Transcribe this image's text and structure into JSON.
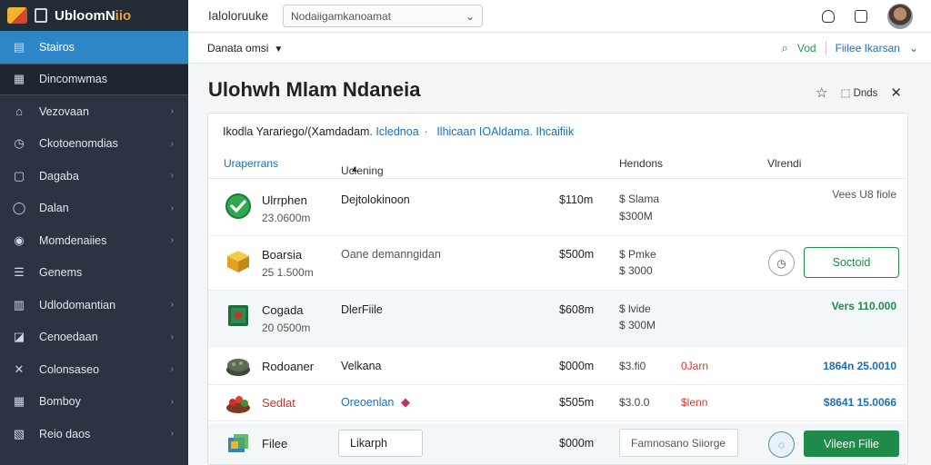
{
  "app": {
    "name_main": "UbloomN",
    "name_accent": "iio",
    "title": "Ialoloruuke"
  },
  "search": {
    "value": "Nodaiigamkanoamat"
  },
  "sidebar": {
    "items": [
      {
        "label": "Stairos",
        "icon": "dashboard-icon",
        "chevron": ""
      },
      {
        "label": "Dincomwmas",
        "icon": "pages-icon",
        "chevron": ""
      },
      {
        "label": "Vezovaan",
        "icon": "home-icon",
        "chevron": "›"
      },
      {
        "label": "Ckotoenomdias",
        "icon": "clock-icon",
        "chevron": "›"
      },
      {
        "label": "Dagaba",
        "icon": "box-icon",
        "chevron": "›"
      },
      {
        "label": "Dalan",
        "icon": "circle-icon",
        "chevron": "›"
      },
      {
        "label": "Momdenaiies",
        "icon": "target-icon",
        "chevron": "›"
      },
      {
        "label": "Genems",
        "icon": "list-icon",
        "chevron": ""
      },
      {
        "label": "Udlodomantian",
        "icon": "book-icon",
        "chevron": "›"
      },
      {
        "label": "Cenoedaan",
        "icon": "tag-icon",
        "chevron": "›"
      },
      {
        "label": "Colonsaseo",
        "icon": "tools-icon",
        "chevron": "›"
      },
      {
        "label": "Bomboy",
        "icon": "calendar-icon",
        "chevron": "›"
      },
      {
        "label": "Reio daos",
        "icon": "files-icon",
        "chevron": "›"
      }
    ]
  },
  "subbar": {
    "dataset": "Danata omsi",
    "vod": "Vod",
    "filter": "Fiilee Ikarsan"
  },
  "page": {
    "title": "Ulohwh Mlam Ndaneia",
    "ends_label": "Dnds"
  },
  "breadcrumb": {
    "part1": "Ikodla Yarariego/(Xamdadam.",
    "part2": "Iclednoa",
    "part3": "Ilhicaan IOAldama. Ihcaifiik"
  },
  "table": {
    "headers": {
      "name": "Uraperrans",
      "identifier": "Uclening",
      "holdings": "Hendons",
      "value": "Vlrendi"
    },
    "rows": [
      {
        "name": "Ulrrphen",
        "sub": "23.0600m",
        "id": "Dejtolokinoon",
        "amount": "$110m",
        "h1": "$ Slama",
        "h2": "$300M",
        "version": "Vees U8 fiole",
        "icon": "check-circle-icon"
      },
      {
        "name": "Boarsia",
        "sub": "25 1.500m",
        "id": "Oane demanngidan",
        "amount": "$500m",
        "h1": "$ Pmke",
        "h2": "$ 3000",
        "action": "Soctoid",
        "icon": "cube-icon"
      },
      {
        "name": "Cogada",
        "sub": "20 0500m",
        "id": "DlerFiile",
        "amount": "$608m",
        "h1": "$ lvide",
        "h2": "$ 300M",
        "version": "Vers 110.000",
        "icon": "book-icon"
      },
      {
        "name": "Rodoaner",
        "id": "Velkana",
        "amount": "$000m",
        "h1": "$3.fi0",
        "alert": "0Jarn",
        "version": "1864n 25.0010",
        "icon": "stack-icon"
      },
      {
        "name": "Sedlat",
        "id": "Oreoenlan",
        "amount": "$505m",
        "h1": "$3.0.0",
        "alert": "$lenn",
        "version": "$8641 15.0066",
        "icon": "cake-icon"
      },
      {
        "name": "Filee",
        "input": "Likarph",
        "amount": "$000m",
        "file_placeholder": "Famnosano Siiorge",
        "action": "Vileen Filie",
        "icon": "package-icon"
      }
    ]
  }
}
